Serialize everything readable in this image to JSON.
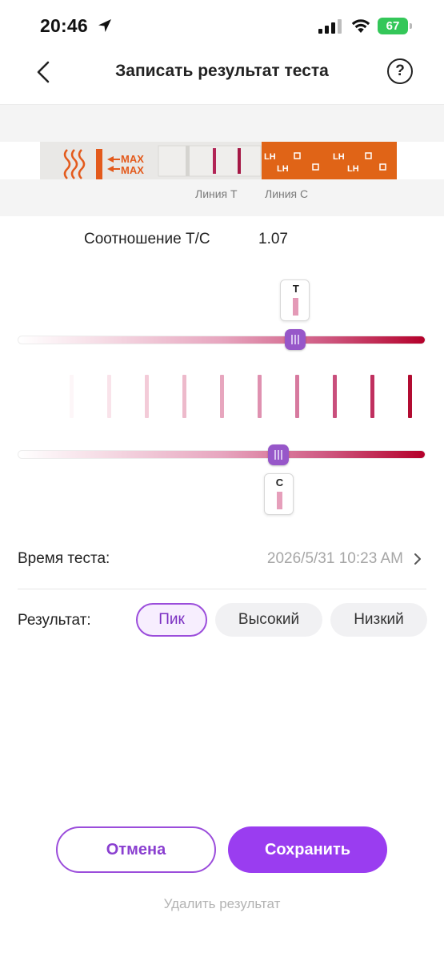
{
  "status_bar": {
    "time": "20:46",
    "battery": "67",
    "icons": [
      "location-arrow-icon",
      "cellular-signal-icon",
      "wifi-icon",
      "battery-icon"
    ]
  },
  "nav": {
    "back_icon": "chevron-left-icon",
    "title": "Записать результат теста",
    "help_label": "?"
  },
  "strip": {
    "line_t_label": "Линия T",
    "line_c_label": "Линия C",
    "max_texts": [
      "MAX",
      "MAX"
    ],
    "lh_texts": [
      "LH",
      "LH",
      "LH",
      "LH"
    ]
  },
  "ratio": {
    "label": "Соотношение T/C",
    "value": "1.07"
  },
  "sliders": {
    "t": {
      "letter": "T",
      "level": 0.68,
      "swatch_color": "#e49ab7"
    },
    "c": {
      "letter": "C",
      "level": 0.64,
      "swatch_color": "#e69fbb"
    }
  },
  "reference_scale": {
    "colors": [
      "#fdf6f8",
      "#f9e3ea",
      "#f3cbd8",
      "#edbacb",
      "#e7a6be",
      "#df91b0",
      "#d77a9f",
      "#c94f7c",
      "#c0305f",
      "#b20c31"
    ]
  },
  "test_time": {
    "label": "Время теста:",
    "value": "2026/5/31 10:23 AM",
    "chevron_icon": "chevron-right-icon"
  },
  "result": {
    "label": "Результат:",
    "options": [
      "Пик",
      "Высокий",
      "Низкий"
    ],
    "selected": "Пик"
  },
  "actions": {
    "cancel": "Отмена",
    "save": "Сохранить",
    "delete": "Удалить результат"
  },
  "colors": {
    "accent": "#9a3df0",
    "accent_border": "#9b4ddb",
    "thumb": "#9757c9",
    "battery": "#34c759"
  }
}
